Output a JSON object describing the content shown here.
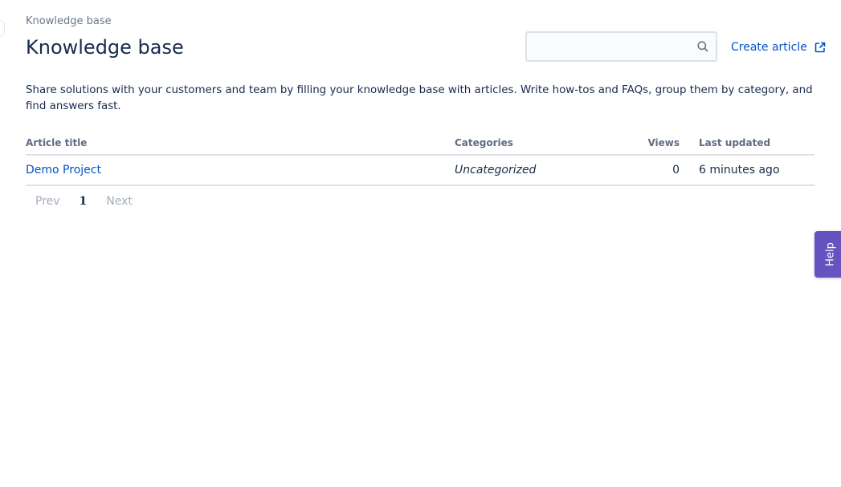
{
  "breadcrumb": "Knowledge base",
  "page_title": "Knowledge base",
  "search": {
    "value": "",
    "placeholder": "",
    "icon": "search-icon"
  },
  "create_article": {
    "label": "Create article",
    "icon": "external-link-icon"
  },
  "description": "Share solutions with your customers and team by filling your knowledge base with articles. Write how-tos and FAQs, group them by category, and find answers fast.",
  "table": {
    "headers": {
      "title": "Article title",
      "categories": "Categories",
      "views": "Views",
      "last_updated": "Last updated"
    },
    "rows": [
      {
        "title": "Demo Project",
        "category": "Uncategorized",
        "views": "0",
        "last_updated": "6 minutes ago"
      }
    ]
  },
  "pagination": {
    "prev": "Prev",
    "current": "1",
    "next": "Next"
  },
  "help_tab": {
    "label": "Help"
  },
  "colors": {
    "link": "#0052cc",
    "text": "#172b4d",
    "muted": "#6b778c",
    "help_tab": "#6554c0",
    "border": "#dfe1e6"
  }
}
